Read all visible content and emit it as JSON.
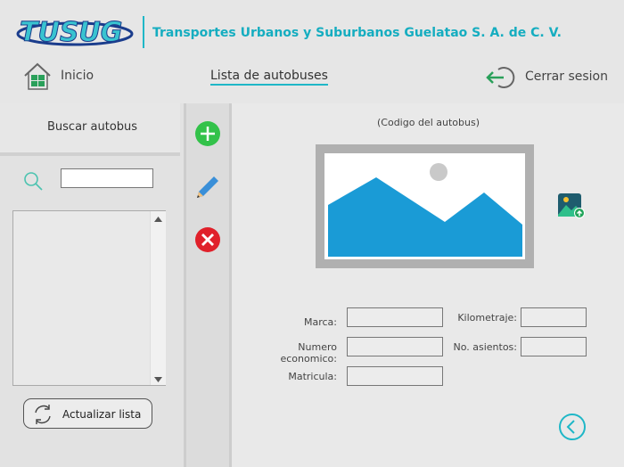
{
  "header": {
    "logo_text": "TUSUG",
    "company_name": "Transportes Urbanos y Suburbanos Guelatao S. A. de C. V.",
    "brand_color": "#15adc0"
  },
  "nav": {
    "home_label": "Inicio",
    "list_label": "Lista de autobuses",
    "logout_label": "Cerrar sesion",
    "home_icon": "home-icon",
    "logout_icon": "logout-icon"
  },
  "sidebar": {
    "search_title": "Buscar autobus",
    "search_value": "",
    "refresh_label": "Actualizar lista",
    "items": []
  },
  "toolbar": {
    "add_icon": "add-icon",
    "edit_icon": "pencil-icon",
    "delete_icon": "delete-icon"
  },
  "details": {
    "code_label": "(Codigo del autobus)",
    "fields": {
      "marca": {
        "label": "Marca:",
        "value": ""
      },
      "numero_economico": {
        "label": "Numero economico:",
        "value": ""
      },
      "matricula": {
        "label": "Matricula:",
        "value": ""
      },
      "kilometraje": {
        "label": "Kilometraje:",
        "value": ""
      },
      "asientos": {
        "label": "No. asientos:",
        "value": ""
      }
    }
  }
}
